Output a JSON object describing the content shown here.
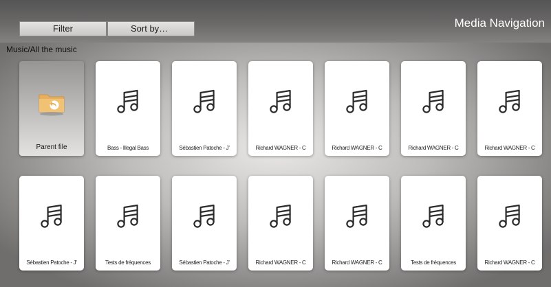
{
  "header": {
    "title": "Media Navigation",
    "tabs": [
      {
        "label": "Filter"
      },
      {
        "label": "Sort by…"
      }
    ]
  },
  "breadcrumb": "Music/All the music",
  "parent_tile": {
    "label": "Parent file",
    "icon": "folder-back-icon"
  },
  "tiles": [
    {
      "label": "Bass - Illegal Bass",
      "icon": "music-note-icon"
    },
    {
      "label": "Sébastien Patoche - J'",
      "icon": "music-note-icon"
    },
    {
      "label": "Richard WAGNER - C",
      "icon": "music-note-icon"
    },
    {
      "label": "Richard WAGNER - C",
      "icon": "music-note-icon"
    },
    {
      "label": "Richard WAGNER - C",
      "icon": "music-note-icon"
    },
    {
      "label": "Richard WAGNER - C",
      "icon": "music-note-icon"
    },
    {
      "label": "Sébastien Patoche - J'",
      "icon": "music-note-icon"
    },
    {
      "label": "Tests de fréquences",
      "icon": "music-note-icon"
    },
    {
      "label": "Sébastien Patoche - J'",
      "icon": "music-note-icon"
    },
    {
      "label": "Richard WAGNER - C",
      "icon": "music-note-icon"
    },
    {
      "label": "Richard WAGNER - C",
      "icon": "music-note-icon"
    },
    {
      "label": "Tests de fréquences",
      "icon": "music-note-icon"
    },
    {
      "label": "Richard WAGNER - C",
      "icon": "music-note-icon"
    }
  ],
  "colors": {
    "folder": "#e8b05c",
    "folder_badge": "#ffffff",
    "music_icon_stroke": "#2b2b2b"
  }
}
